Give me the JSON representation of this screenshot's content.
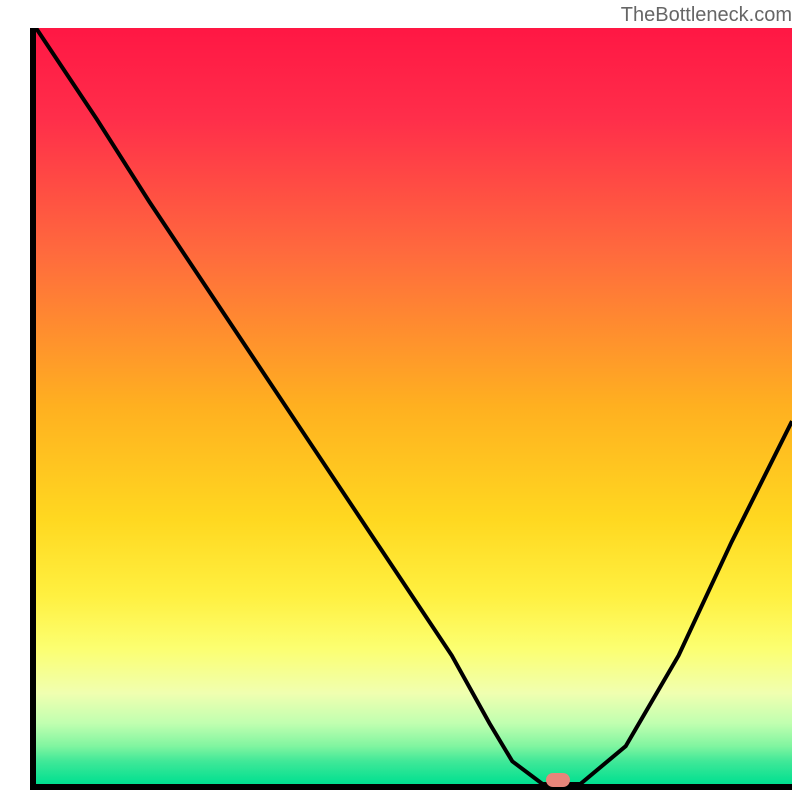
{
  "watermark": "TheBottleneck.com",
  "chart_data": {
    "type": "line",
    "title": "",
    "xlabel": "",
    "ylabel": "",
    "xlim": [
      0,
      100
    ],
    "ylim": [
      0,
      100
    ],
    "background_gradient": {
      "stops": [
        {
          "offset": 0,
          "color": "#ff1744"
        },
        {
          "offset": 12,
          "color": "#ff2e4a"
        },
        {
          "offset": 30,
          "color": "#ff6b3d"
        },
        {
          "offset": 50,
          "color": "#ffb020"
        },
        {
          "offset": 65,
          "color": "#ffd820"
        },
        {
          "offset": 75,
          "color": "#fff040"
        },
        {
          "offset": 82,
          "color": "#fcff70"
        },
        {
          "offset": 88,
          "color": "#f0ffb0"
        },
        {
          "offset": 92,
          "color": "#c0ffb0"
        },
        {
          "offset": 95,
          "color": "#80f5a0"
        },
        {
          "offset": 97,
          "color": "#40e898"
        },
        {
          "offset": 100,
          "color": "#00e090"
        }
      ]
    },
    "series": [
      {
        "name": "bottleneck-curve",
        "color": "#000000",
        "x": [
          0,
          8,
          15,
          25,
          35,
          45,
          55,
          60,
          63,
          67,
          72,
          78,
          85,
          92,
          100
        ],
        "y": [
          100,
          88,
          77,
          62,
          47,
          32,
          17,
          8,
          3,
          0,
          0,
          5,
          17,
          32,
          48
        ]
      }
    ],
    "marker": {
      "x": 69,
      "y": 0.5,
      "color": "#e8857a"
    }
  }
}
